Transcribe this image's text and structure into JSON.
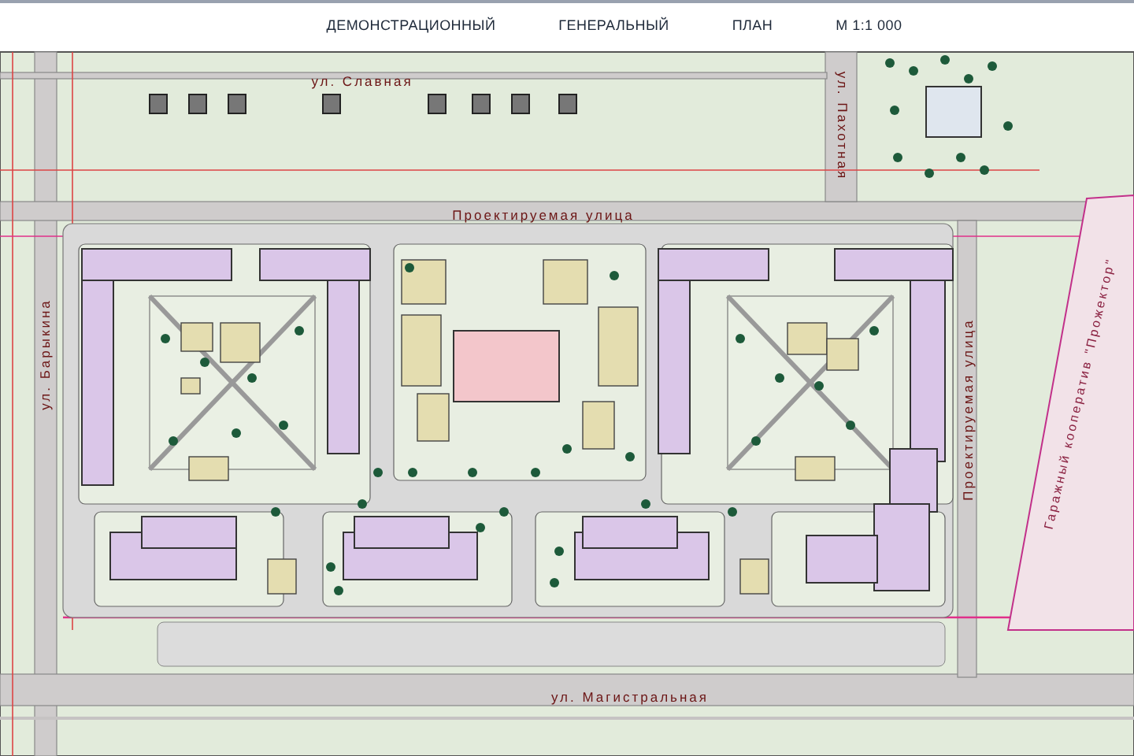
{
  "title": {
    "words": [
      "ДЕМОНСТРАЦИОННЫЙ",
      "ГЕНЕРАЛЬНЫЙ",
      "ПЛАН",
      "М 1:1 000"
    ]
  },
  "labels": [
    {
      "text": "ул. Славная",
      "kind": "street"
    },
    {
      "text": "ул. Пахотная",
      "kind": "street"
    },
    {
      "text": "Проектируемая улица",
      "kind": "street"
    },
    {
      "text": "ул. Барыкина",
      "kind": "street"
    },
    {
      "text": "Проектируемая улица",
      "kind": "street"
    },
    {
      "text": "ул. Магистральная",
      "kind": "street"
    },
    {
      "text": "Гаражный кооператив \"Прожектор\"",
      "kind": "area"
    }
  ]
}
